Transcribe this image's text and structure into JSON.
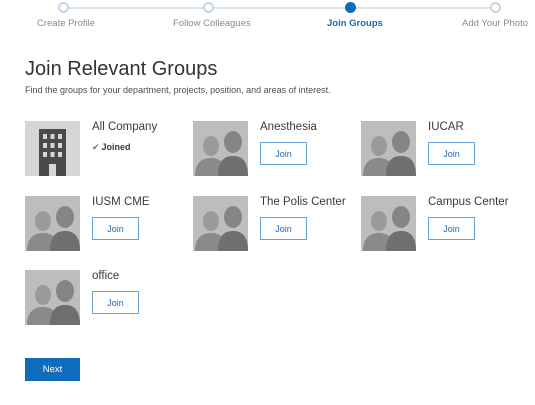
{
  "stepper": {
    "steps": [
      {
        "label": "Create Profile",
        "state": "done"
      },
      {
        "label": "Follow Colleagues",
        "state": "done"
      },
      {
        "label": "Join Groups",
        "state": "current"
      },
      {
        "label": "Add Your Photo",
        "state": "todo"
      }
    ]
  },
  "header": {
    "title": "Join Relevant Groups",
    "subtitle": "Find the groups for your department, projects, position, and areas of interest."
  },
  "groups": [
    {
      "name": "All Company",
      "icon": "building-icon",
      "status": "Joined"
    },
    {
      "name": "Anesthesia",
      "icon": "people-icon",
      "button": "Join"
    },
    {
      "name": "IUCAR",
      "icon": "people-icon",
      "button": "Join"
    },
    {
      "name": "IUSM CME",
      "icon": "people-icon",
      "button": "Join"
    },
    {
      "name": "The Polis Center",
      "icon": "people-icon",
      "button": "Join"
    },
    {
      "name": "Campus Center",
      "icon": "people-icon",
      "button": "Join"
    },
    {
      "name": "office",
      "icon": "people-icon",
      "button": "Join"
    }
  ],
  "footer": {
    "next_label": "Next"
  },
  "colors": {
    "accent": "#0f6cbd",
    "joined_check": "#2e9b46",
    "thumb_bg": "#bdbdbd"
  }
}
